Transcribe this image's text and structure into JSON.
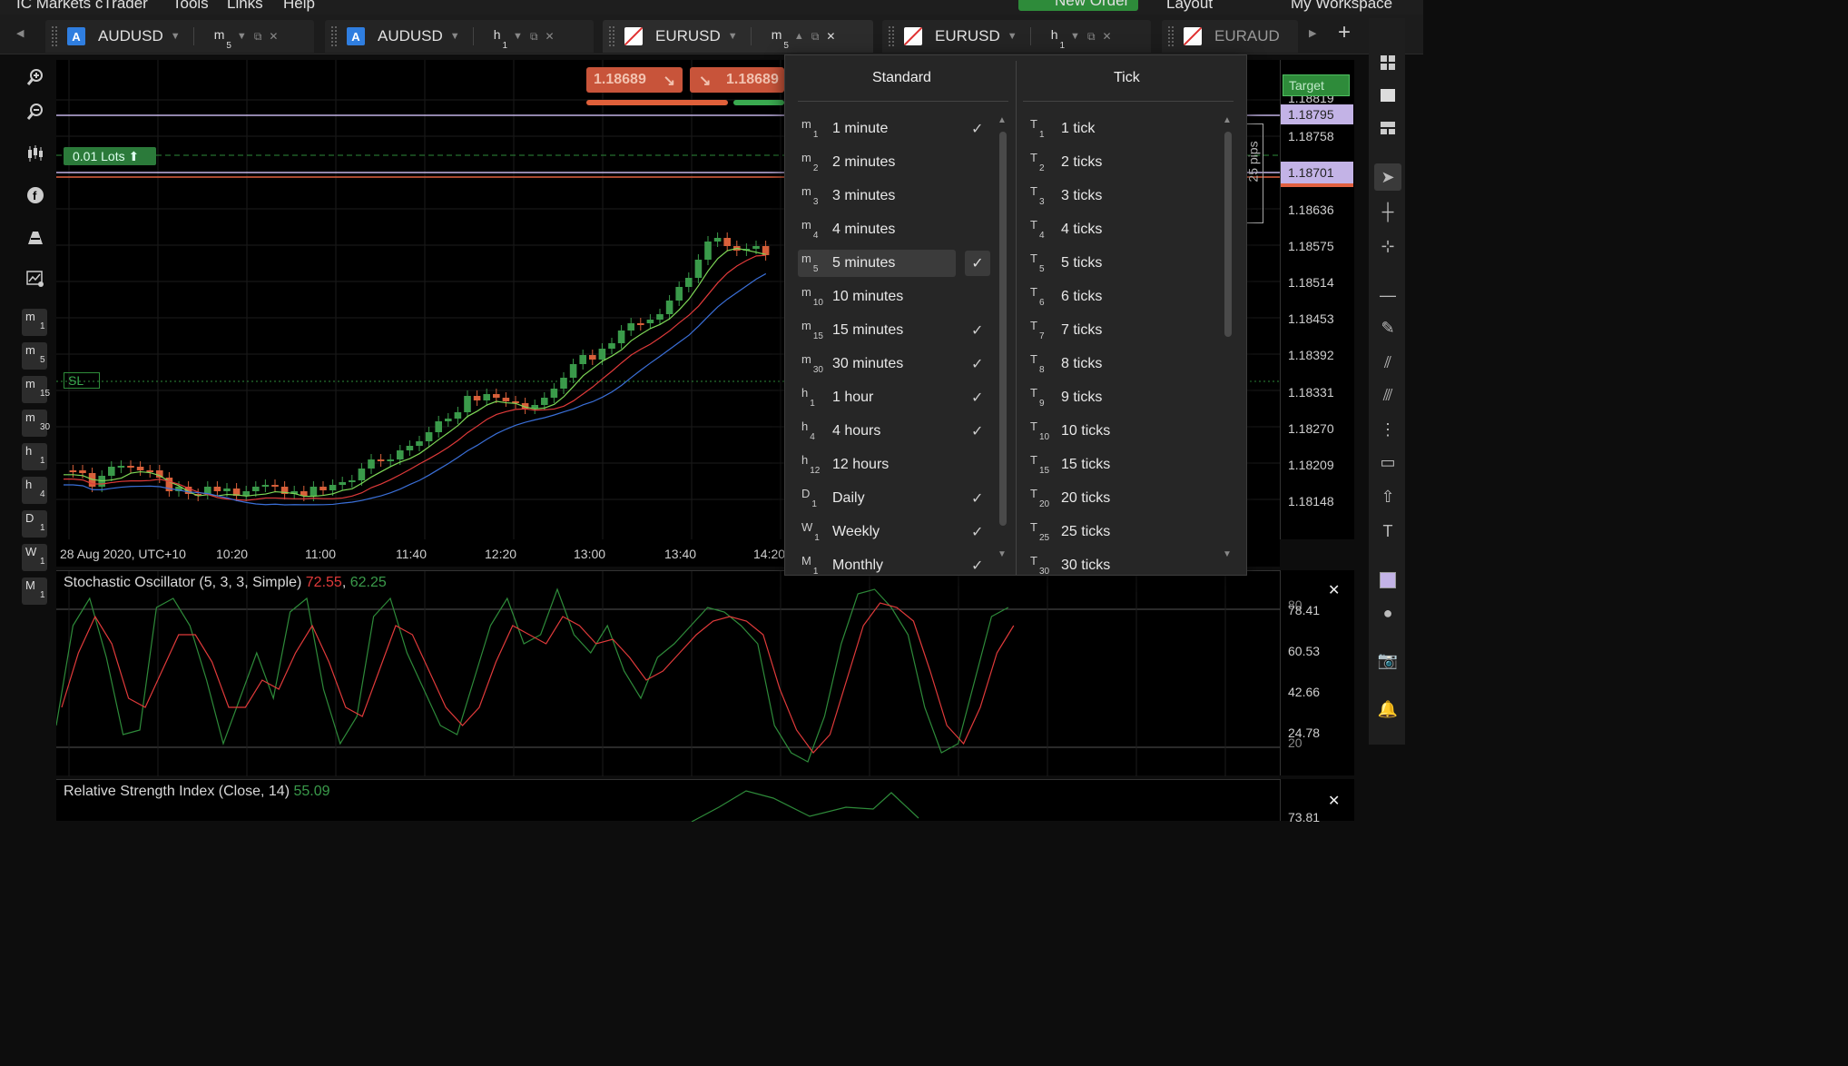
{
  "menu": [
    "IC Markets cTrader",
    "Tools",
    "Links",
    "Help"
  ],
  "toolbar": {
    "new_order": "New Order",
    "layout": "Layout",
    "workspace": "My Workspace"
  },
  "tabs": [
    {
      "symbol": "AUDUSD",
      "icon": "A",
      "tf_letter": "m",
      "tf_num": "5"
    },
    {
      "symbol": "AUDUSD",
      "icon": "A",
      "tf_letter": "h",
      "tf_num": "1"
    },
    {
      "symbol": "EURUSD",
      "icon": "flag",
      "tf_letter": "m",
      "tf_num": "5"
    },
    {
      "symbol": "EURUSD",
      "icon": "flag",
      "tf_letter": "h",
      "tf_num": "1"
    },
    {
      "symbol": "EURAUD",
      "icon": "flag"
    }
  ],
  "left_timeframes": [
    {
      "l": "m",
      "n": "1"
    },
    {
      "l": "m",
      "n": "5"
    },
    {
      "l": "m",
      "n": "15"
    },
    {
      "l": "m",
      "n": "30"
    },
    {
      "l": "h",
      "n": "1"
    },
    {
      "l": "h",
      "n": "4"
    },
    {
      "l": "D",
      "n": "1"
    },
    {
      "l": "W",
      "n": "1"
    },
    {
      "l": "M",
      "n": "1"
    }
  ],
  "chart": {
    "sell_price": "1.18689",
    "buy_price": "1.18689",
    "lots": "0.01 Lots",
    "sl": "SL",
    "target": "Target",
    "pips": "25 pips",
    "price_labels": [
      "1.18819",
      "1.18758",
      "1.18636",
      "1.18575",
      "1.18514",
      "1.18453",
      "1.18392",
      "1.18331",
      "1.18270",
      "1.18209",
      "1.18148"
    ],
    "price_tag_purple": "1.18795",
    "price_tag_current": "1.18701",
    "time_labels": [
      "28 Aug 2020, UTC+10",
      "10:20",
      "11:00",
      "11:40",
      "12:20",
      "13:00",
      "13:40",
      "14:20"
    ],
    "colors": {
      "bull": "#3a9a4a",
      "bear": "#d8603a",
      "ma_fast": "#7ed957",
      "ma_mid": "#e03a3a",
      "ma_slow": "#3a6fd8"
    }
  },
  "dropdown": {
    "standard_header": "Standard",
    "tick_header": "Tick",
    "standard": [
      {
        "code": "m",
        "n": "1",
        "label": "1 minute",
        "checked": true
      },
      {
        "code": "m",
        "n": "2",
        "label": "2 minutes",
        "checked": false
      },
      {
        "code": "m",
        "n": "3",
        "label": "3 minutes",
        "checked": false
      },
      {
        "code": "m",
        "n": "4",
        "label": "4 minutes",
        "checked": false
      },
      {
        "code": "m",
        "n": "5",
        "label": "5 minutes",
        "checked": true,
        "selected": true
      },
      {
        "code": "m",
        "n": "10",
        "label": "10 minutes",
        "checked": false
      },
      {
        "code": "m",
        "n": "15",
        "label": "15 minutes",
        "checked": true
      },
      {
        "code": "m",
        "n": "30",
        "label": "30 minutes",
        "checked": true
      },
      {
        "code": "h",
        "n": "1",
        "label": "1 hour",
        "checked": true
      },
      {
        "code": "h",
        "n": "4",
        "label": "4 hours",
        "checked": true
      },
      {
        "code": "h",
        "n": "12",
        "label": "12 hours",
        "checked": false
      },
      {
        "code": "D",
        "n": "1",
        "label": "Daily",
        "checked": true
      },
      {
        "code": "W",
        "n": "1",
        "label": "Weekly",
        "checked": true
      },
      {
        "code": "M",
        "n": "1",
        "label": "Monthly",
        "checked": true
      }
    ],
    "tick": [
      {
        "code": "T",
        "n": "1",
        "label": "1 tick"
      },
      {
        "code": "T",
        "n": "2",
        "label": "2 ticks"
      },
      {
        "code": "T",
        "n": "3",
        "label": "3 ticks"
      },
      {
        "code": "T",
        "n": "4",
        "label": "4 ticks"
      },
      {
        "code": "T",
        "n": "5",
        "label": "5 ticks"
      },
      {
        "code": "T",
        "n": "6",
        "label": "6 ticks"
      },
      {
        "code": "T",
        "n": "7",
        "label": "7 ticks"
      },
      {
        "code": "T",
        "n": "8",
        "label": "8 ticks"
      },
      {
        "code": "T",
        "n": "9",
        "label": "9 ticks"
      },
      {
        "code": "T",
        "n": "10",
        "label": "10 ticks"
      },
      {
        "code": "T",
        "n": "15",
        "label": "15 ticks"
      },
      {
        "code": "T",
        "n": "20",
        "label": "20 ticks"
      },
      {
        "code": "T",
        "n": "25",
        "label": "25 ticks"
      },
      {
        "code": "T",
        "n": "30",
        "label": "30 ticks"
      }
    ]
  },
  "stoch": {
    "title": "Stochastic Oscillator (5, 3, 3, Simple)",
    "k": "72.55",
    "d": "62.25",
    "levels": [
      "78.41",
      "60.53",
      "42.66",
      "24.78"
    ],
    "band_hi": "80",
    "band_lo": "20"
  },
  "rsi": {
    "title": "Relative Strength Index (Close, 14)",
    "value": "55.09",
    "axis": "73.81"
  }
}
